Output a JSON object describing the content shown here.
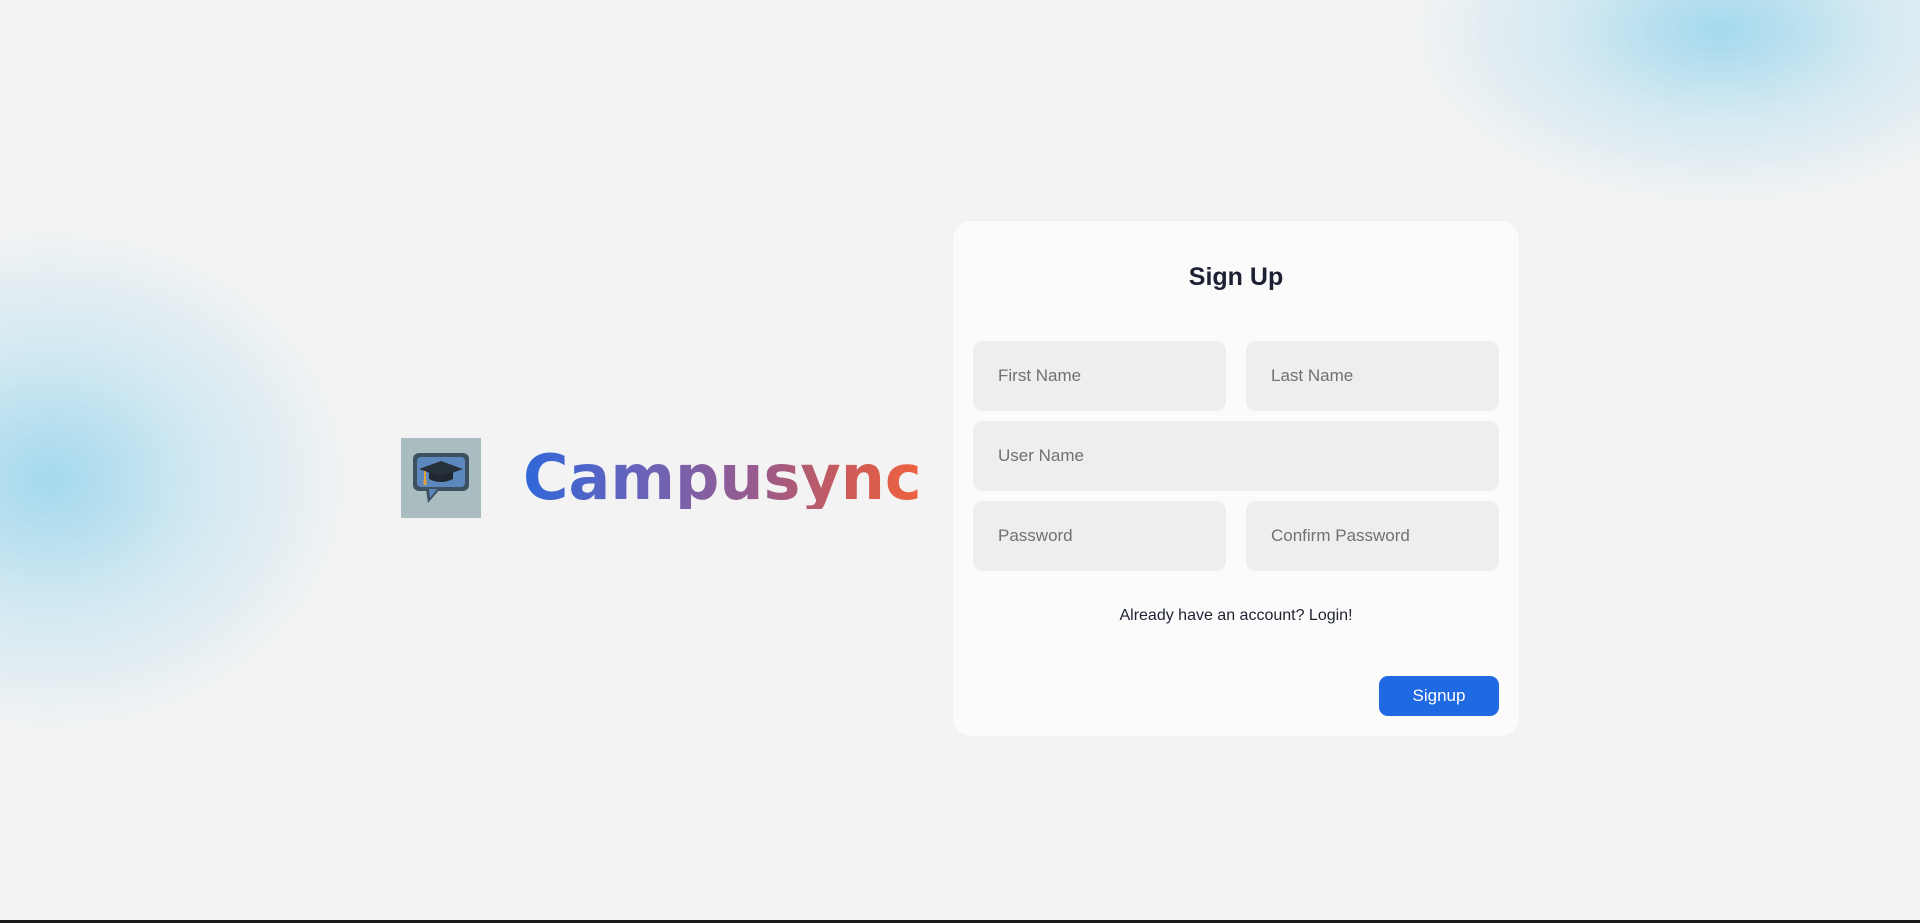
{
  "brand": {
    "name": "Campusync",
    "logo_icon": "graduation-cap-speech-bubble-icon"
  },
  "signup_form": {
    "title": "Sign Up",
    "first_name_placeholder": "First Name",
    "last_name_placeholder": "Last Name",
    "user_name_placeholder": "User Name",
    "password_placeholder": "Password",
    "confirm_password_placeholder": "Confirm Password",
    "login_prompt": "Already have an account? Login!",
    "submit_label": "Signup"
  },
  "colors": {
    "background": "#f3f3f3",
    "card": "#fbfbfb",
    "field": "#edeeed",
    "primary_button": "#1f69e3",
    "brand_gradient_start": "#2f67d9",
    "brand_gradient_end": "#f0623e",
    "accent_glow": "#96d4ec"
  }
}
